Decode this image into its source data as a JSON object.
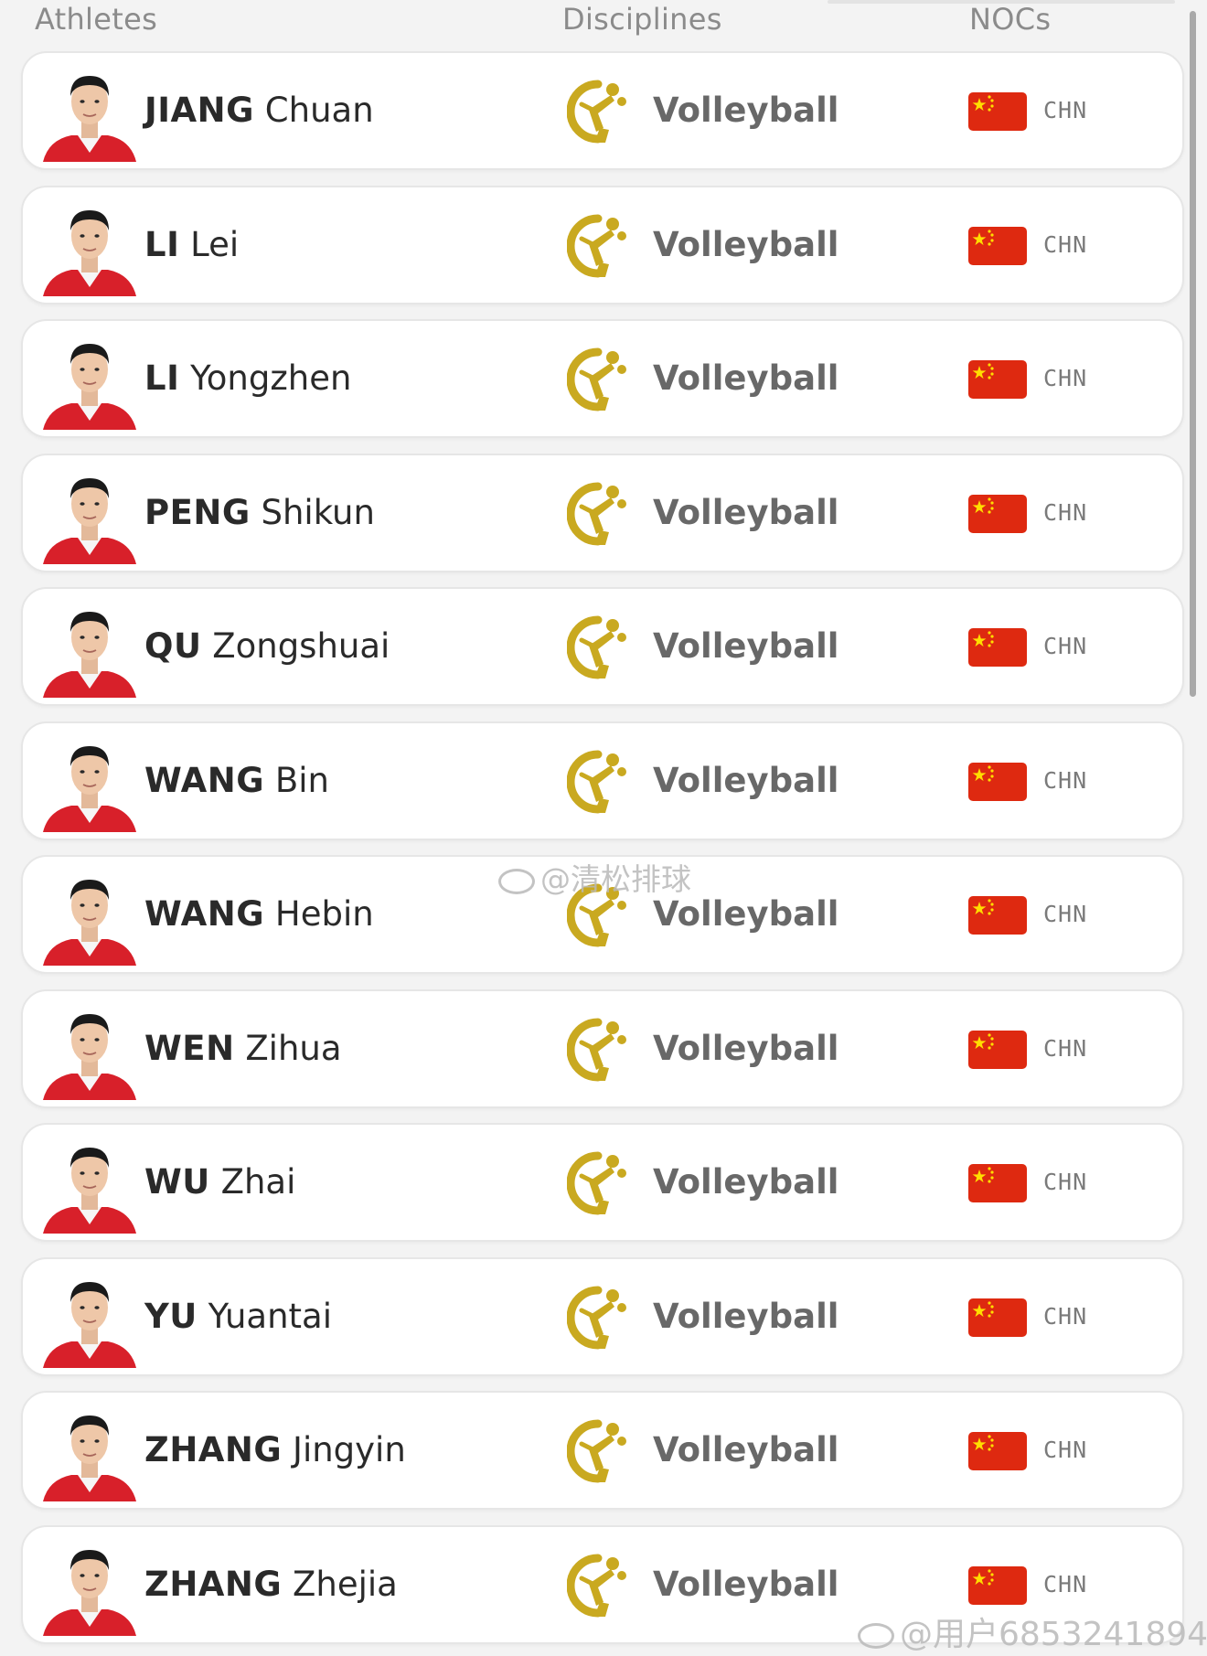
{
  "header": {
    "athletes": "Athletes",
    "disciplines": "Disciplines",
    "nocs": "NOCs"
  },
  "rows": [
    {
      "last": "JIANG",
      "first": "Chuan",
      "discipline": "Volleyball",
      "noc": "CHN"
    },
    {
      "last": "LI",
      "first": "Lei",
      "discipline": "Volleyball",
      "noc": "CHN"
    },
    {
      "last": "LI",
      "first": "Yongzhen",
      "discipline": "Volleyball",
      "noc": "CHN"
    },
    {
      "last": "PENG",
      "first": "Shikun",
      "discipline": "Volleyball",
      "noc": "CHN"
    },
    {
      "last": "QU",
      "first": "Zongshuai",
      "discipline": "Volleyball",
      "noc": "CHN"
    },
    {
      "last": "WANG",
      "first": "Bin",
      "discipline": "Volleyball",
      "noc": "CHN"
    },
    {
      "last": "WANG",
      "first": "Hebin",
      "discipline": "Volleyball",
      "noc": "CHN"
    },
    {
      "last": "WEN",
      "first": "Zihua",
      "discipline": "Volleyball",
      "noc": "CHN"
    },
    {
      "last": "WU",
      "first": "Zhai",
      "discipline": "Volleyball",
      "noc": "CHN"
    },
    {
      "last": "YU",
      "first": "Yuantai",
      "discipline": "Volleyball",
      "noc": "CHN"
    },
    {
      "last": "ZHANG",
      "first": "Jingyin",
      "discipline": "Volleyball",
      "noc": "CHN"
    },
    {
      "last": "ZHANG",
      "first": "Zhejia",
      "discipline": "Volleyball",
      "noc": "CHN"
    }
  ],
  "watermarks": {
    "center": "@清松排球",
    "corner": "@用户6853241894"
  },
  "icons": {
    "discipline": "volleyball-pictogram-icon",
    "flag": "china-flag-icon",
    "watermark": "weibo-icon"
  },
  "colors": {
    "pictogram": "#c9a920",
    "flag_red": "#de2910",
    "flag_star": "#ffde00",
    "jersey_red": "#d8202a"
  }
}
